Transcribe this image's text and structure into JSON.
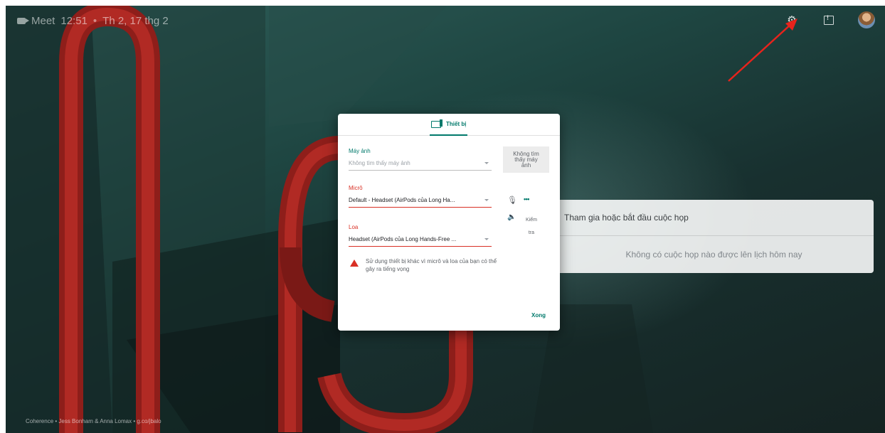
{
  "topbar": {
    "app_name": "Meet",
    "time": "12:51",
    "separator": "•",
    "date": "Th 2, 17 thg 2",
    "icons": [
      "settings-icon",
      "feedback-icon",
      "avatar"
    ]
  },
  "meet_panel": {
    "join_label": "Tham gia hoặc bắt đầu cuộc họp",
    "empty_label": "Không có cuộc họp nào được lên lịch hôm nay"
  },
  "credits": "Coherence • Jess Bonham & Anna Lomax • g.co/jbalo",
  "modal": {
    "tab_label": "Thiết bị",
    "camera": {
      "label": "Máy ảnh",
      "value": "Không tìm thấy máy ảnh",
      "preview_text": "Không tìm\nthấy máy\nảnh"
    },
    "microphone": {
      "label": "Micrô",
      "value": "Default - Headset (AirPods của Long Ha...",
      "level_indicator": "•••"
    },
    "speaker": {
      "label": "Loa",
      "value": "Headset (AirPods của Long Hands-Free ...",
      "test_label": "Kiểm\ntra"
    },
    "warning": "Sử dụng thiết bị khác vì micrô và loa của bạn có thể gây ra tiếng vọng",
    "done_label": "Xong"
  },
  "colors": {
    "accent_teal": "#00796b",
    "error_red": "#d93025",
    "annotation_arrow": "#e8231c"
  }
}
